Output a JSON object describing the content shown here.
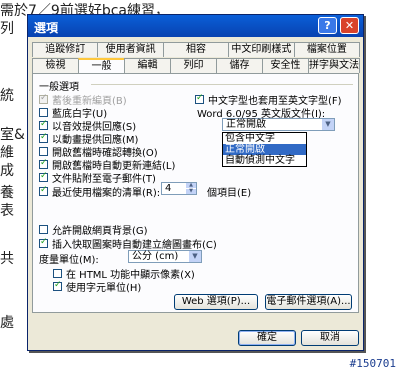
{
  "background": {
    "lines": [
      "需於7／9前選好bca練習，",
      "列",
      "統",
      "室&",
      "維",
      "成",
      "養",
      "表",
      "共",
      "處"
    ]
  },
  "watermark": "#150701",
  "dialog": {
    "title": "選項",
    "help_glyph": "?",
    "close_glyph": "✕",
    "tabs_row1": [
      "追蹤修訂",
      "使用者資訊",
      "相容",
      "中文印刷樣式",
      "檔案位置"
    ],
    "tabs_row2": [
      "檢視",
      "一般",
      "編輯",
      "列印",
      "儲存",
      "安全性",
      "拼字與文法"
    ],
    "active_tab": "一般",
    "group_label": "一般選項",
    "options_left": [
      {
        "label": "蓄後重新編頁(B)",
        "checked": true,
        "disabled": true
      },
      {
        "label": "藍底白字(U)",
        "checked": false,
        "disabled": false
      },
      {
        "label": "以音效提供回應(S)",
        "checked": true,
        "disabled": false
      },
      {
        "label": "以動畫提供回應(M)",
        "checked": true,
        "disabled": false
      },
      {
        "label": "開啟舊檔時確認轉換(O)",
        "checked": false,
        "disabled": false
      },
      {
        "label": "開啟舊檔時自動更新連結(L)",
        "checked": true,
        "disabled": false
      },
      {
        "label": "文件貼附至電子郵件(T)",
        "checked": true,
        "disabled": false
      },
      {
        "label": "最近使用檔案的清單(R):",
        "checked": true,
        "disabled": false
      }
    ],
    "recent_files_count": "4",
    "recent_files_suffix": "個項目(E)",
    "right_option": {
      "label": "中文字型也套用至英文字型(F)",
      "checked": true
    },
    "word_file_label": "Word 6.0/95 英文版文件(I):",
    "word_file_selected": "正常開啟",
    "word_file_options": [
      "包含中文字",
      "正常開啟",
      "自動偵測中文字"
    ],
    "options_lower": [
      {
        "label": "允許開啟網頁背景(G)",
        "checked": false
      },
      {
        "label": "插入快取圖案時自動建立繪圖畫布(C)",
        "checked": true
      }
    ],
    "measure_label": "度量單位(M):",
    "measure_value": "公分 (cm)",
    "options_bottom": [
      {
        "label": "在 HTML 功能中顯示像素(X)",
        "checked": false
      },
      {
        "label": "使用字元單位(H)",
        "checked": true
      }
    ],
    "web_options_button": "Web 選項(P)...",
    "email_options_button": "電子郵件選項(A)...",
    "ok_button": "確定",
    "cancel_button": "取消"
  }
}
